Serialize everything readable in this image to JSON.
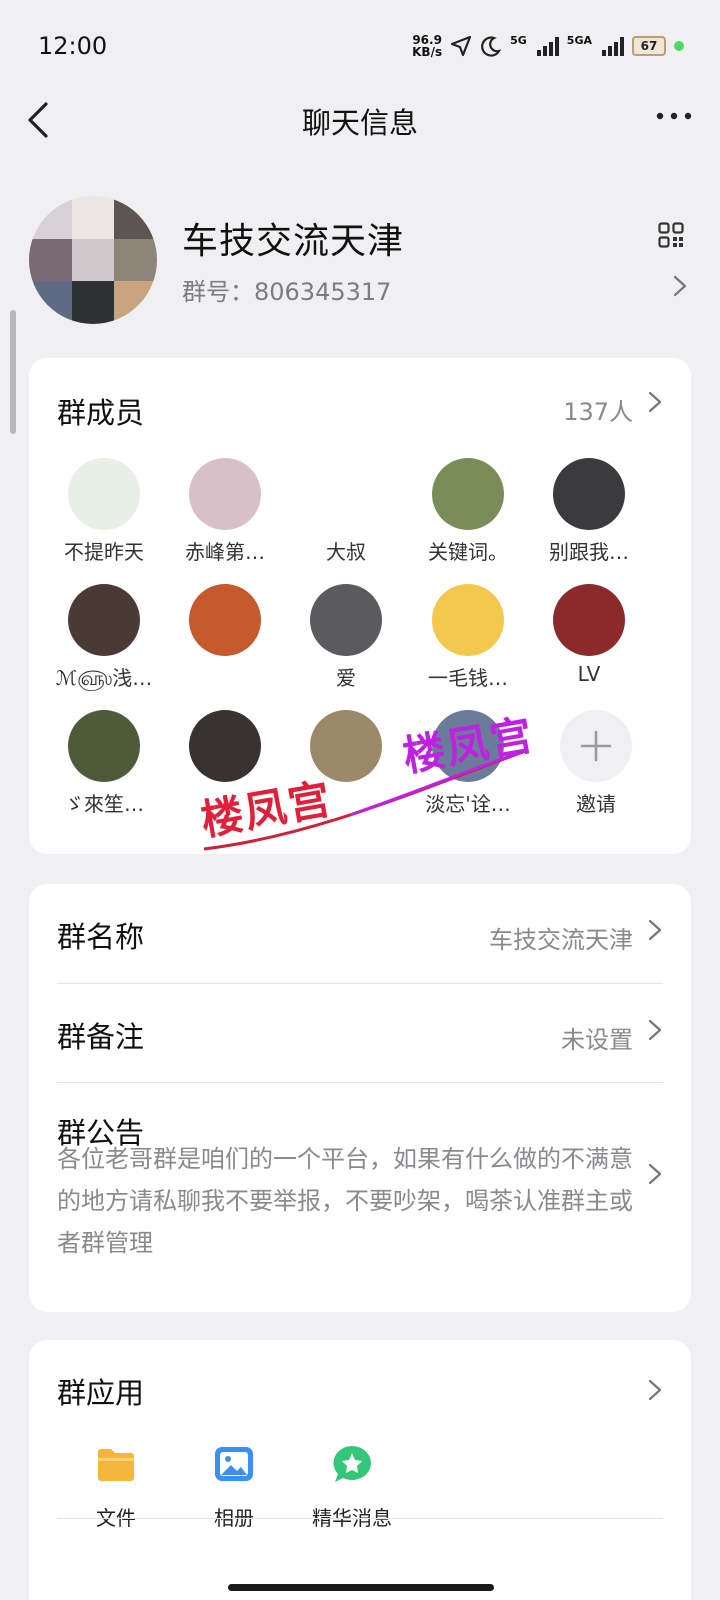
{
  "status": {
    "time": "12:00",
    "net_speed_value": "96.9",
    "net_speed_unit": "KB/s",
    "sig1_label": "5G",
    "sig2_label": "5GA",
    "battery": "67"
  },
  "nav": {
    "title": "聊天信息"
  },
  "group": {
    "name": "车技交流天津",
    "id_text": "群号：806345317"
  },
  "members": {
    "title": "群成员",
    "count": "137人",
    "list": [
      {
        "name": "不提昨天",
        "color": "#e8efe4"
      },
      {
        "name": "赤峰第…",
        "color": "#d9c0c8"
      },
      {
        "name": "大叔",
        "color": "#ffffff"
      },
      {
        "name": "关键词。",
        "color": "#7a8c5a"
      },
      {
        "name": "别跟我…",
        "color": "#3b3a3c"
      },
      {
        "name": "ℳ௵浅…",
        "color": "#4a3a36"
      },
      {
        "name": "",
        "color": "#c45a2e"
      },
      {
        "name": "爱",
        "color": "#5b5b5e"
      },
      {
        "name": "一毛钱…",
        "color": "#f2c94c"
      },
      {
        "name": "LV",
        "color": "#8a2a2a"
      },
      {
        "name": "ゞ來笙…",
        "color": "#4e5a3a"
      },
      {
        "name": "",
        "color": "#3a3232"
      },
      {
        "name": "",
        "color": "#9a8a6a"
      },
      {
        "name": "淡忘'诠…",
        "color": "#6a7c9a"
      }
    ],
    "invite_label": "邀请"
  },
  "watermark": {
    "text": "楼凤宫"
  },
  "settings": {
    "name_label": "群名称",
    "name_value": "车技交流天津",
    "remark_label": "群备注",
    "remark_value": "未设置",
    "notice_label": "群公告",
    "notice_text": "各位老哥群是咱们的一个平台，如果有什么做的不满意的地方请私聊我不要举报，不要吵架，喝茶认准群主或者群管理"
  },
  "apps": {
    "title": "群应用",
    "items": [
      {
        "label": "文件",
        "icon": "folder-icon",
        "color": "#f5b73b"
      },
      {
        "label": "相册",
        "icon": "photo-album-icon",
        "color": "#3d8ff5"
      },
      {
        "label": "精华消息",
        "icon": "star-bubble-icon",
        "color": "#34c77b"
      }
    ]
  }
}
